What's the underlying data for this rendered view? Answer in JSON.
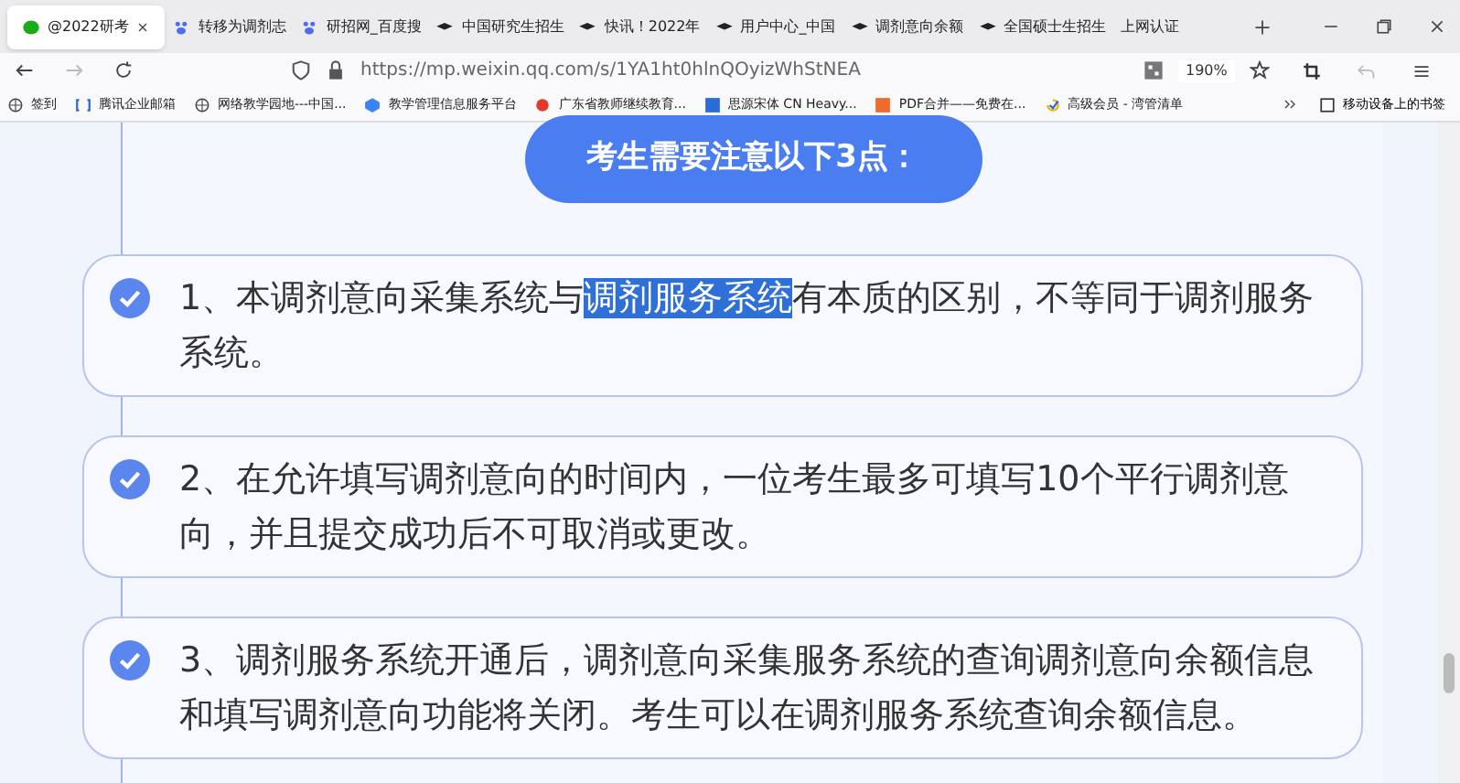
{
  "tabs": [
    {
      "label": "@2022研考",
      "selected": true
    },
    {
      "label": "转移为调剂志",
      "selected": false
    },
    {
      "label": "研招网_百度搜",
      "selected": false
    },
    {
      "label": "中国研究生招生",
      "selected": false
    },
    {
      "label": "快讯！2022年",
      "selected": false
    },
    {
      "label": "用户中心_中国",
      "selected": false
    },
    {
      "label": "调剂意向余额",
      "selected": false
    },
    {
      "label": "全国硕士生招生",
      "selected": false
    },
    {
      "label": "上网认证",
      "selected": false
    }
  ],
  "address": {
    "url": "https://mp.weixin.qq.com/s/1YA1ht0hlnQOyizWhStNEA",
    "zoom": "190%"
  },
  "bookmarks": [
    {
      "label": "签到"
    },
    {
      "label": "腾讯企业邮箱"
    },
    {
      "label": "网络教学园地---中国..."
    },
    {
      "label": "教学管理信息服务平台"
    },
    {
      "label": "广东省教师继续教育..."
    },
    {
      "label": "思源宋体 CN Heavy..."
    },
    {
      "label": "PDF合并——免费在..."
    },
    {
      "label": "高级会员 - 湾管清单"
    }
  ],
  "mobile_bookmarks": "移动设备上的书签",
  "heading": "考生需要注意以下3点：",
  "notes": [
    {
      "text_before": "1、本调剂意向采集系统与",
      "selected_text": "调剂服务系统",
      "text_after": "有本质的区别，不等同于调剂服务系统。"
    },
    {
      "text_before": "2、在允许填写调剂意向的时间内，一位考生最多可填写10个平行调剂意向，并且提交成功后不可取消或更改。"
    },
    {
      "text_before": "3、调剂服务系统开通后，调剂意向采集服务系统的查询调剂意向余额信息和填写调剂意向功能将关闭。考生可以在调剂服务系统查询余额信息。"
    }
  ]
}
